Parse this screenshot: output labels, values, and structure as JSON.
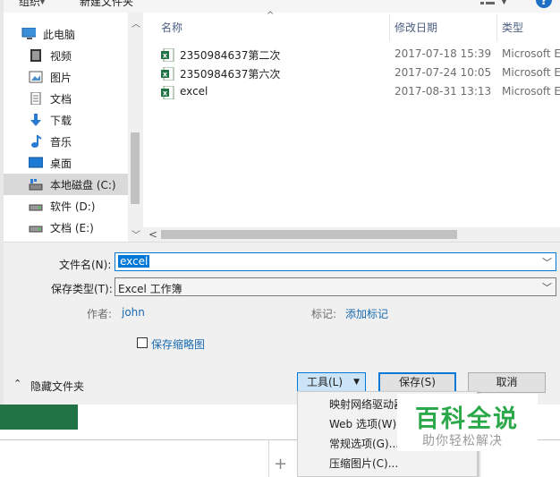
{
  "toolbar": {
    "organize": "组织",
    "new_folder": "新建文件夹"
  },
  "nav": {
    "items": [
      {
        "label": "此电脑"
      },
      {
        "label": "视频"
      },
      {
        "label": "图片"
      },
      {
        "label": "文档"
      },
      {
        "label": "下载"
      },
      {
        "label": "音乐"
      },
      {
        "label": "桌面"
      },
      {
        "label": "本地磁盘 (C:)"
      },
      {
        "label": "软件 (D:)"
      },
      {
        "label": "文档 (E:)"
      }
    ]
  },
  "filelist": {
    "headers": {
      "name": "名称",
      "modified": "修改日期",
      "type": "类型"
    },
    "rows": [
      {
        "name": "2350984637第二次",
        "modified": "2017-07-18 15:39",
        "type": "Microsoft E"
      },
      {
        "name": "2350984637第六次",
        "modified": "2017-07-24 10:05",
        "type": "Microsoft E"
      },
      {
        "name": "excel",
        "modified": "2017-08-31 13:13",
        "type": "Microsoft E"
      }
    ]
  },
  "form": {
    "filename_label": "文件名(N):",
    "filename_value": "excel",
    "savetype_label": "保存类型(T):",
    "savetype_value": "Excel 工作簿",
    "author_label": "作者:",
    "author_value": "john",
    "tags_label": "标记:",
    "tags_value": "添加标记",
    "thumbnail_label": "保存缩略图"
  },
  "footer": {
    "hide_folders": "隐藏文件夹",
    "tools": "工具(L)",
    "save": "保存(S)",
    "cancel": "取消"
  },
  "tools_menu": {
    "items": [
      {
        "label": "映射网络驱动器"
      },
      {
        "label": "Web 选项(W)..."
      },
      {
        "label": "常规选项(G)..."
      },
      {
        "label": "压缩图片(C)..."
      }
    ]
  },
  "watermark": {
    "title": "百科全说",
    "subtitle": "助你轻松解决"
  },
  "colors": {
    "accent": "#0078d7",
    "excel_green": "#217346",
    "watermark_green": "#2aa84a"
  },
  "icons": [
    "pc-icon",
    "video-icon",
    "pictures-icon",
    "documents-icon",
    "download-icon",
    "music-icon",
    "desktop-icon",
    "drive-icon",
    "excel-file-icon",
    "chevron-down-icon",
    "chevron-up-icon",
    "help-icon",
    "view-icon",
    "plus-icon"
  ]
}
